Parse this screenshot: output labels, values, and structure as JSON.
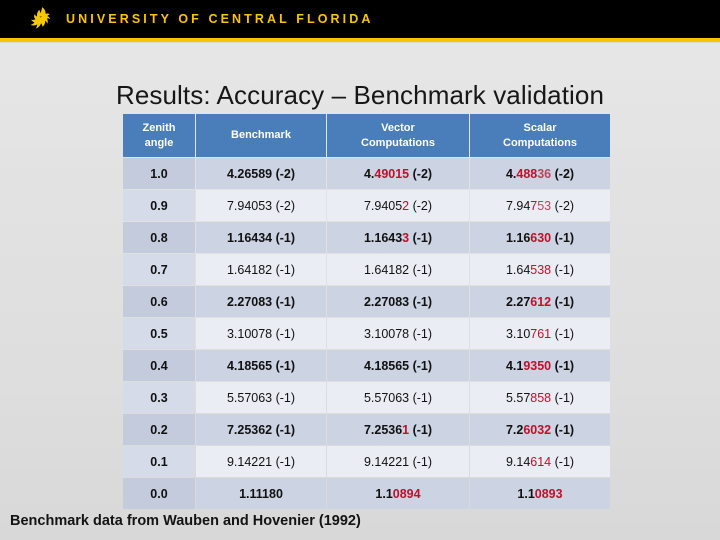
{
  "brand": {
    "wordmark": "UNIVERSITY OF CENTRAL FLORIDA",
    "logo_icon": "ucf-pegasus-icon",
    "band_color": "#000000",
    "accent_color": "#f5c500",
    "wordmark_color": "#fcc400"
  },
  "slide": {
    "title": "Results: Accuracy – Benchmark validation",
    "footer": "Benchmark data from Wauben and Hovenier (1992)"
  },
  "table": {
    "header_bg": "#4a7ebb",
    "highlight_color": "#c0102a",
    "columns": [
      {
        "line1": "Zenith",
        "line2": "angle"
      },
      {
        "line1": "Benchmark",
        "line2": ""
      },
      {
        "line1": "Vector",
        "line2": "Computations"
      },
      {
        "line1": "Scalar",
        "line2": "Computations"
      }
    ],
    "rows": [
      {
        "zenith": "1.0",
        "benchmark": {
          "black": "4.26589 (-2)",
          "red": ""
        },
        "vector": {
          "black": "4.",
          "red": "49015",
          "tail": " (-2)"
        },
        "scalar": {
          "black": "4.",
          "red": "488",
          "red_soft": "36",
          "tail": " (-2)"
        }
      },
      {
        "zenith": "0.9",
        "benchmark": {
          "black": "7.94053 (-2)",
          "red": ""
        },
        "vector": {
          "black": "7.9405",
          "red": "2",
          "tail": " (-2)"
        },
        "scalar": {
          "black": "7.94",
          "red": "7",
          "red_soft": "53",
          "tail": " (-2)"
        }
      },
      {
        "zenith": "0.8",
        "benchmark": {
          "black": "1.16434 (-1)",
          "red": ""
        },
        "vector": {
          "black": "1.1643",
          "red": "3",
          "tail": " (-1)"
        },
        "scalar": {
          "black": "1.16",
          "red": "630",
          "red_soft": "",
          "tail": " (-1)"
        }
      },
      {
        "zenith": "0.7",
        "benchmark": {
          "black": "1.64182 (-1)",
          "red": ""
        },
        "vector": {
          "black": "1.64182",
          "red": "",
          "tail": " (-1)"
        },
        "scalar": {
          "black": "1.64",
          "red": "538",
          "red_soft": "",
          "tail": " (-1)"
        }
      },
      {
        "zenith": "0.6",
        "benchmark": {
          "black": "2.27083 (-1)",
          "red": ""
        },
        "vector": {
          "black": "2.27083",
          "red": "",
          "tail": " (-1)"
        },
        "scalar": {
          "black": "2.27",
          "red": "612",
          "red_soft": "",
          "tail": " (-1)"
        }
      },
      {
        "zenith": "0.5",
        "benchmark": {
          "black": "3.10078 (-1)",
          "red": ""
        },
        "vector": {
          "black": "3.10078",
          "red": "",
          "tail": " (-1)"
        },
        "scalar": {
          "black": "3.10",
          "red": "761",
          "red_soft": "",
          "tail": " (-1)"
        }
      },
      {
        "zenith": "0.4",
        "benchmark": {
          "black": "4.18565 (-1)",
          "red": ""
        },
        "vector": {
          "black": "4.18565",
          "red": "",
          "tail": " (-1)"
        },
        "scalar": {
          "black": "4.1",
          "red": "9350",
          "red_soft": "",
          "tail": " (-1)"
        }
      },
      {
        "zenith": "0.3",
        "benchmark": {
          "black": "5.57063 (-1)",
          "red": ""
        },
        "vector": {
          "black": "5.57063",
          "red": "",
          "tail": " (-1)"
        },
        "scalar": {
          "black": "5.57",
          "red": "858",
          "red_soft": "",
          "tail": " (-1)"
        }
      },
      {
        "zenith": "0.2",
        "benchmark": {
          "black": "7.25362 (-1)",
          "red": ""
        },
        "vector": {
          "black": "7.2536",
          "red": "1",
          "tail": " (-1)"
        },
        "scalar": {
          "black": "7.2",
          "red": "6032",
          "red_soft": "",
          "tail": " (-1)"
        }
      },
      {
        "zenith": "0.1",
        "benchmark": {
          "black": "9.14221 (-1)",
          "red": ""
        },
        "vector": {
          "black": "9.14221",
          "red": "",
          "tail": " (-1)"
        },
        "scalar": {
          "black": "9.14",
          "red": "614",
          "red_soft": "",
          "tail": " (-1)"
        }
      },
      {
        "zenith": "0.0",
        "benchmark": {
          "black": "1.11180",
          "red": ""
        },
        "vector": {
          "black": "1.1",
          "red": "0894",
          "tail": ""
        },
        "scalar": {
          "black": "1.1",
          "red": "0893",
          "red_soft": "",
          "tail": ""
        }
      }
    ]
  }
}
